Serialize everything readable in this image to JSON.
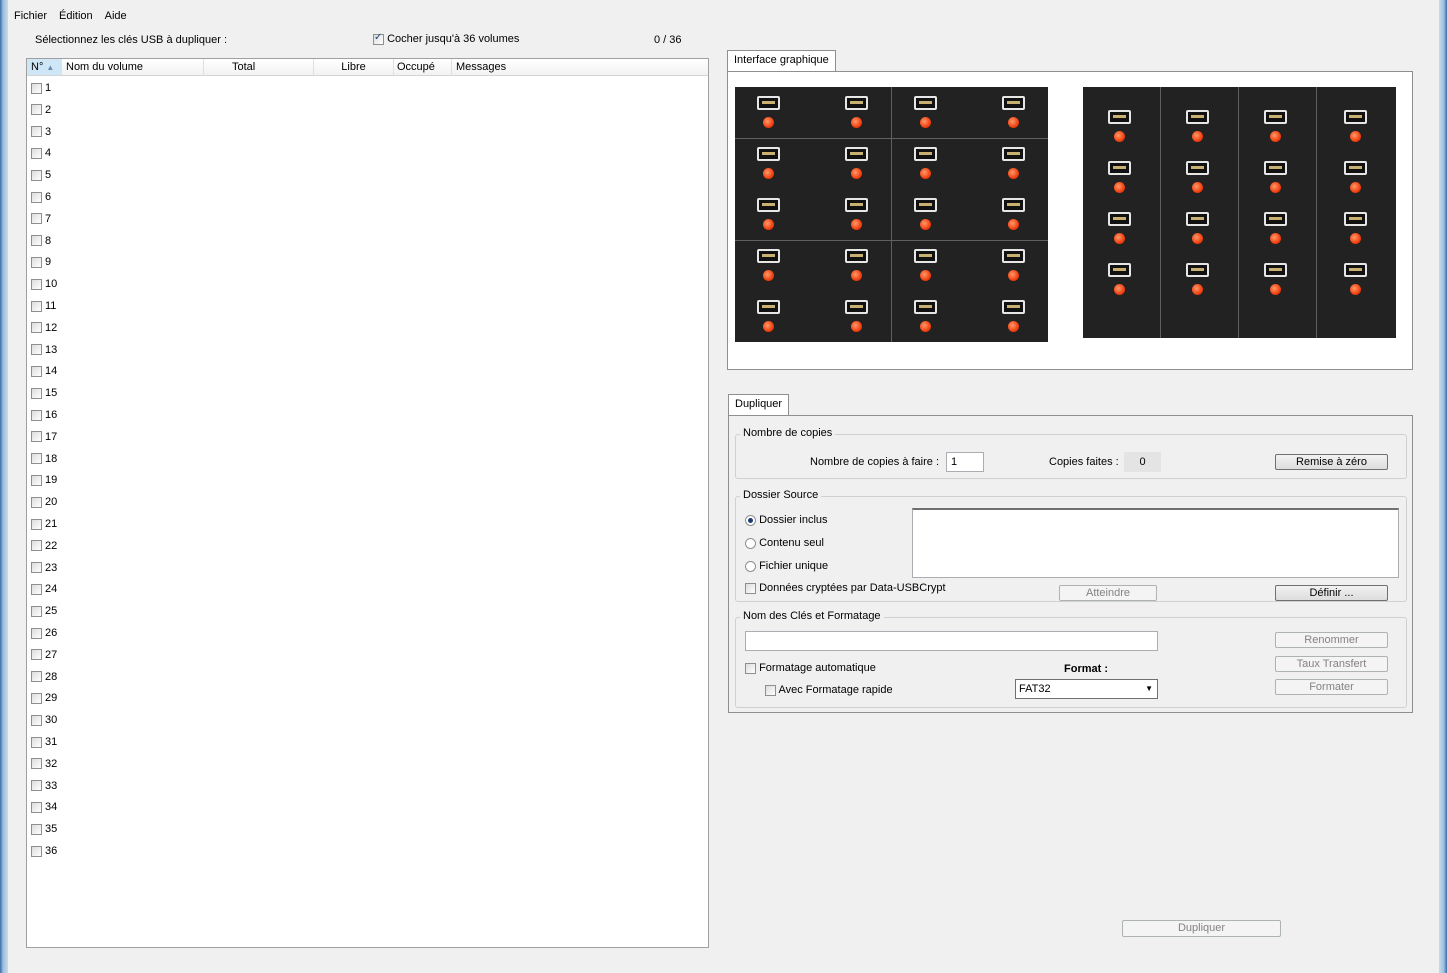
{
  "menu": {
    "file": "Fichier",
    "edit": "Édition",
    "help": "Aide"
  },
  "toolbar": {
    "select_label": "Sélectionnez les clés USB à dupliquer :",
    "check_up_to_label": "Cocher jusqu'à 36 volumes",
    "counter": "0 / 36"
  },
  "volumes": {
    "columns": [
      "N°",
      "Nom du volume",
      "Total",
      "Libre",
      "Occupé",
      "Messages"
    ],
    "rows": [
      "1",
      "2",
      "3",
      "4",
      "5",
      "6",
      "7",
      "8",
      "9",
      "10",
      "11",
      "12",
      "13",
      "14",
      "15",
      "16",
      "17",
      "18",
      "19",
      "20",
      "21",
      "22",
      "23",
      "24",
      "25",
      "26",
      "27",
      "28",
      "29",
      "30",
      "31",
      "32",
      "33",
      "34",
      "35",
      "36"
    ]
  },
  "graphic": {
    "tab_label": "Interface graphique",
    "led_color": "#f04010"
  },
  "duplicate": {
    "tab_label": "Dupliquer",
    "copies": {
      "group_title": "Nombre de copies",
      "to_make_label": "Nombre de copies à faire :",
      "to_make_value": "1",
      "done_label": "Copies faites :",
      "done_value": "0",
      "reset_button": "Remise à zéro"
    },
    "source": {
      "group_title": "Dossier Source",
      "option_included": "Dossier inclus",
      "option_content": "Contenu seul",
      "option_single_file": "Fichier unique",
      "encrypted_label": "Données cryptées par Data-USBCrypt",
      "goto_button": "Atteindre",
      "define_button": "Définir ..."
    },
    "naming": {
      "group_title": "Nom des Clés et Formatage",
      "rename_button": "Renommer",
      "transfer_rate_button": "Taux Transfert",
      "auto_format_label": "Formatage automatique",
      "quick_format_label": "Avec Formatage rapide",
      "format_label": "Format :",
      "format_value": "FAT32",
      "format_button": "Formater"
    },
    "duplicate_button": "Dupliquer"
  }
}
